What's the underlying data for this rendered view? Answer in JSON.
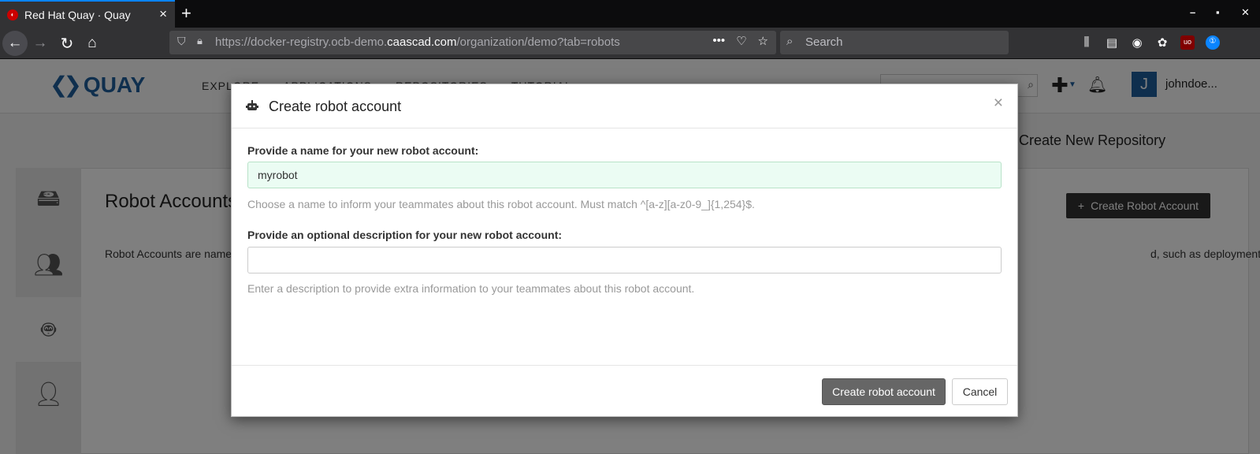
{
  "browser": {
    "tab_title": "Red Hat Quay · Quay",
    "tab_close": "×",
    "new_tab": "+",
    "window_minimize": "–",
    "window_maximize": "▪",
    "window_close": "✕",
    "url_prefix": "https://docker-registry.ocb-demo.",
    "url_host": "caascad.com",
    "url_suffix": "/organization/demo?tab=robots",
    "search_placeholder": "Search",
    "icons": [
      "back-arrow-icon",
      "forward-arrow-icon",
      "reload-icon",
      "home-icon",
      "shield-icon",
      "lock-icon",
      "more-icon",
      "pocket-icon",
      "bookmark-star-icon",
      "library-icon",
      "sidebar-icon",
      "account-icon",
      "extension-icon",
      "ublock-icon",
      "password-manager-icon"
    ]
  },
  "quay": {
    "logo_text": "QUAY",
    "nav": [
      "EXPLORE",
      "APPLICATIONS",
      "REPOSITORIES",
      "TUTORIAL"
    ],
    "username": "johndoe...",
    "avatar_letter": "J",
    "create_repo_label": "Create New Repository",
    "robot_heading": "Robot Accounts",
    "robot_desc_left": "Robot Accounts are name",
    "robot_desc_right": "d, such as deployment systems.",
    "create_robot_btn": "Create Robot Account",
    "accent_color": "#1f5f9c"
  },
  "modal": {
    "title": "Create robot account",
    "close": "×",
    "name_label": "Provide a name for your new robot account:",
    "name_value": "myrobot",
    "name_help": "Choose a name to inform your teammates about this robot account. Must match ^[a-z][a-z0-9_]{1,254}$.",
    "desc_label": "Provide an optional description for your new robot account:",
    "desc_value": "",
    "desc_help": "Enter a description to provide extra information to your teammates about this robot account.",
    "submit_label": "Create robot account",
    "cancel_label": "Cancel"
  }
}
